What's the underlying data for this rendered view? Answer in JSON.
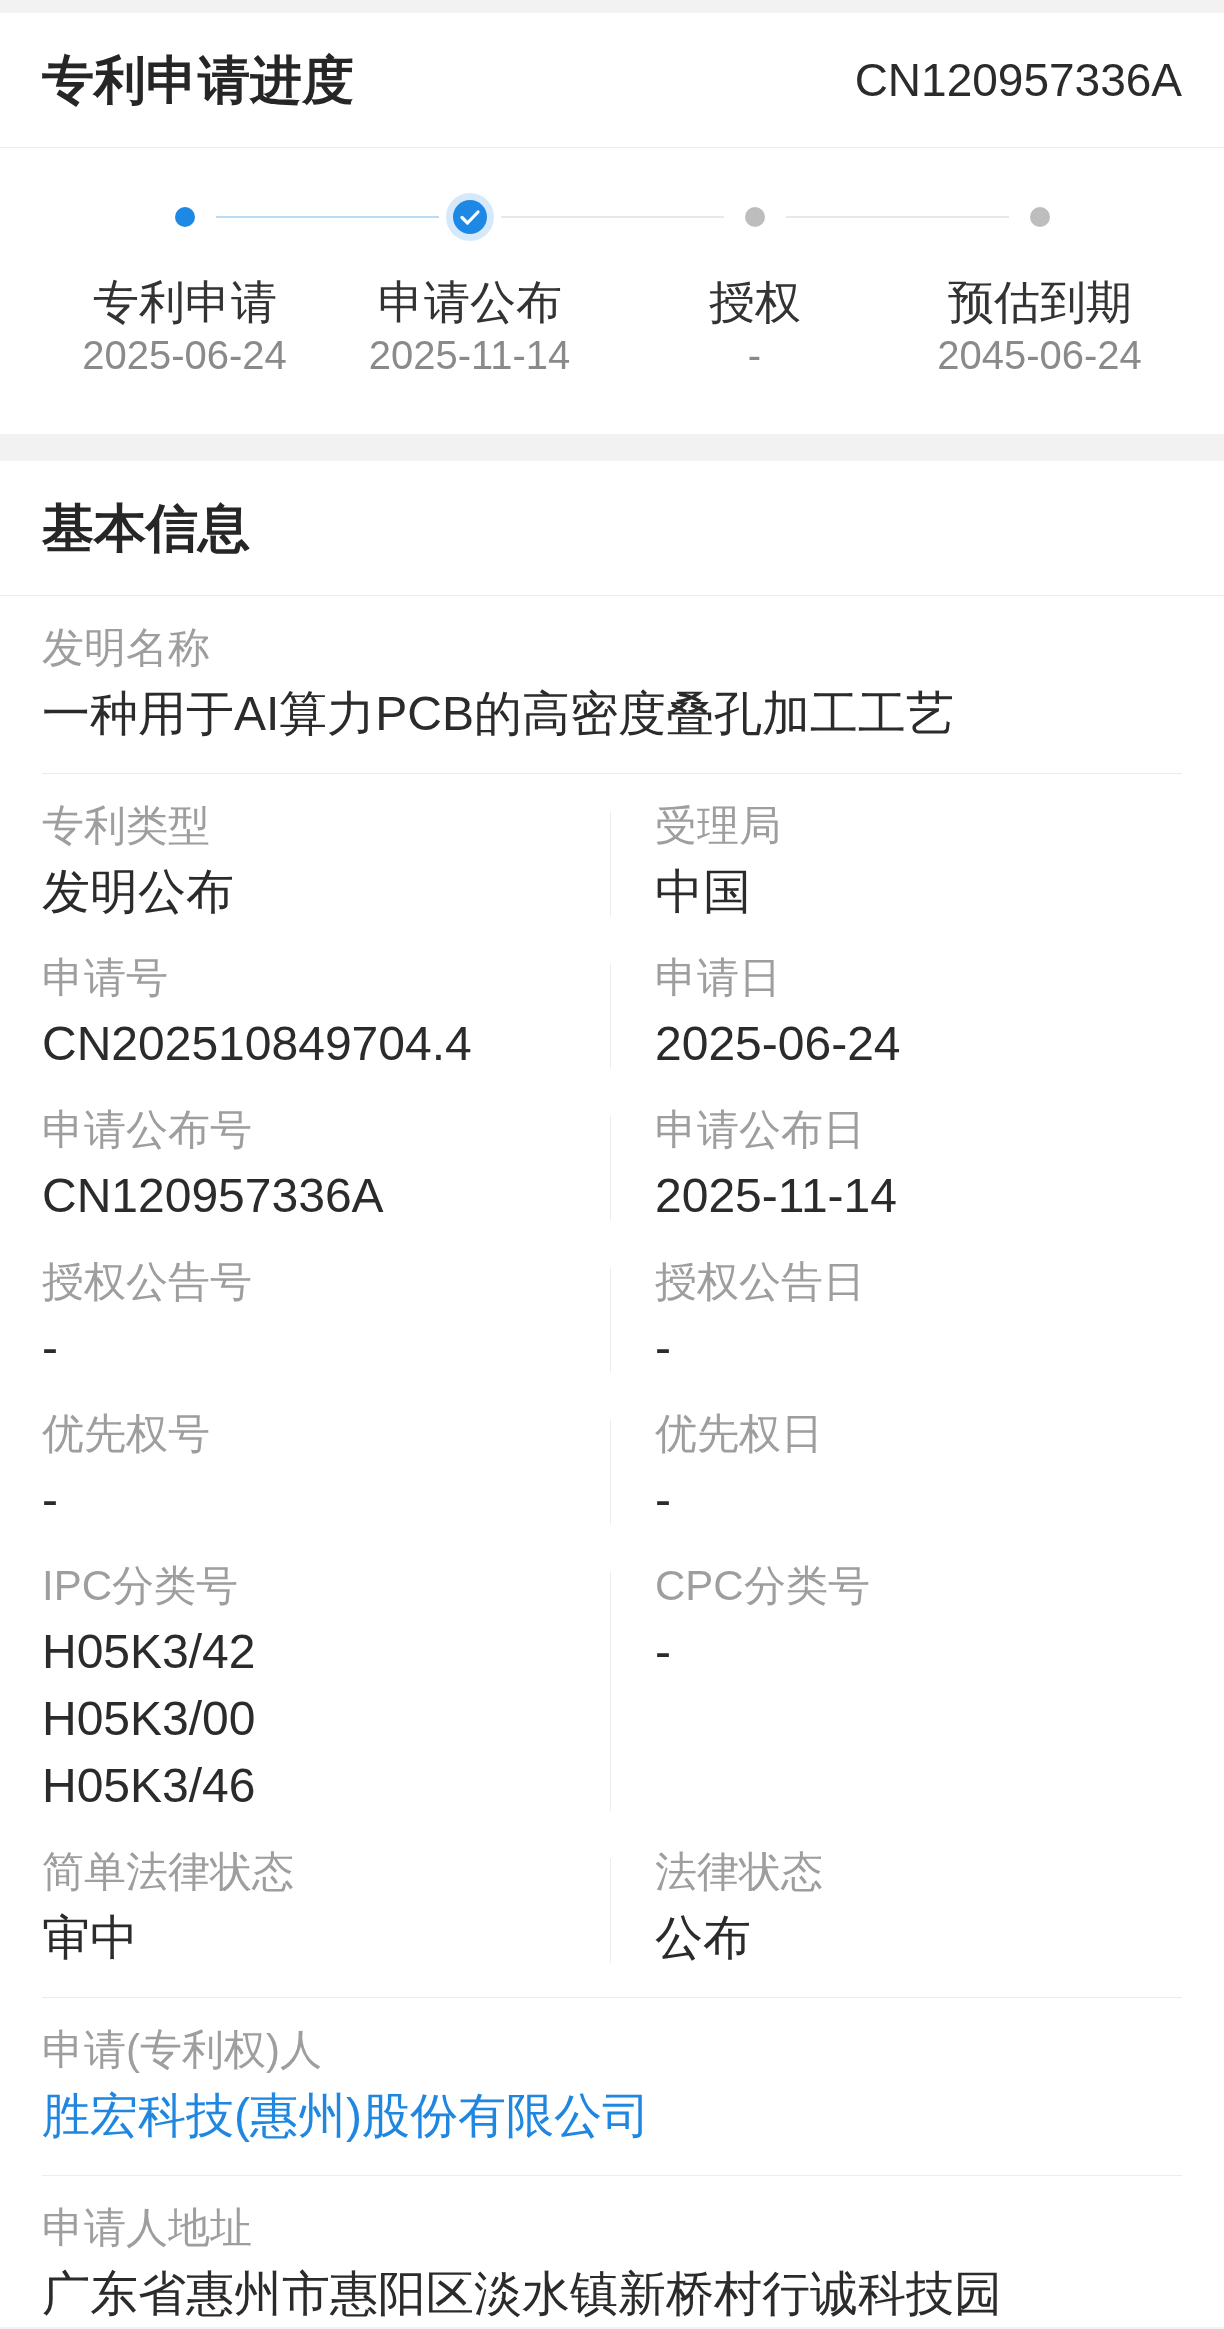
{
  "progress": {
    "title": "专利申请进度",
    "number": "CN120957336A",
    "steps": [
      {
        "label": "专利申请",
        "date": "2025-06-24",
        "kind": "done"
      },
      {
        "label": "申请公布",
        "date": "2025-11-14",
        "kind": "current"
      },
      {
        "label": "授权",
        "date": "-",
        "kind": "pending"
      },
      {
        "label": "预估到期",
        "date": "2045-06-24",
        "kind": "pending"
      }
    ]
  },
  "basic_info": {
    "title": "基本信息",
    "fields": [
      {
        "kind": "text",
        "label": "发明名称",
        "value": "一种用于AI算力PCB的高密度叠孔加工工艺"
      },
      {
        "kind": "grid",
        "rows": [
          [
            {
              "label": "专利类型",
              "values": [
                "发明公布"
              ]
            },
            {
              "label": "受理局",
              "values": [
                "中国"
              ]
            }
          ],
          [
            {
              "label": "申请号",
              "values": [
                "CN202510849704.4"
              ]
            },
            {
              "label": "申请日",
              "values": [
                "2025-06-24"
              ]
            }
          ],
          [
            {
              "label": "申请公布号",
              "values": [
                "CN120957336A"
              ]
            },
            {
              "label": "申请公布日",
              "values": [
                "2025-11-14"
              ]
            }
          ],
          [
            {
              "label": "授权公告号",
              "values": [
                "-"
              ]
            },
            {
              "label": "授权公告日",
              "values": [
                "-"
              ]
            }
          ],
          [
            {
              "label": "优先权号",
              "values": [
                "-"
              ]
            },
            {
              "label": "优先权日",
              "values": [
                "-"
              ]
            }
          ],
          [
            {
              "label": "IPC分类号",
              "values": [
                "H05K3/42",
                "H05K3/00",
                "H05K3/46"
              ]
            },
            {
              "label": "CPC分类号",
              "values": [
                "-"
              ]
            }
          ],
          [
            {
              "label": "简单法律状态",
              "values": [
                "审中"
              ]
            },
            {
              "label": "法律状态",
              "values": [
                "公布"
              ]
            }
          ]
        ]
      },
      {
        "kind": "link",
        "label": "申请(专利权)人",
        "value": "胜宏科技(惠州)股份有限公司"
      },
      {
        "kind": "text",
        "label": "申请人地址",
        "value": "广东省惠州市惠阳区淡水镇新桥村行诚科技园"
      }
    ]
  }
}
